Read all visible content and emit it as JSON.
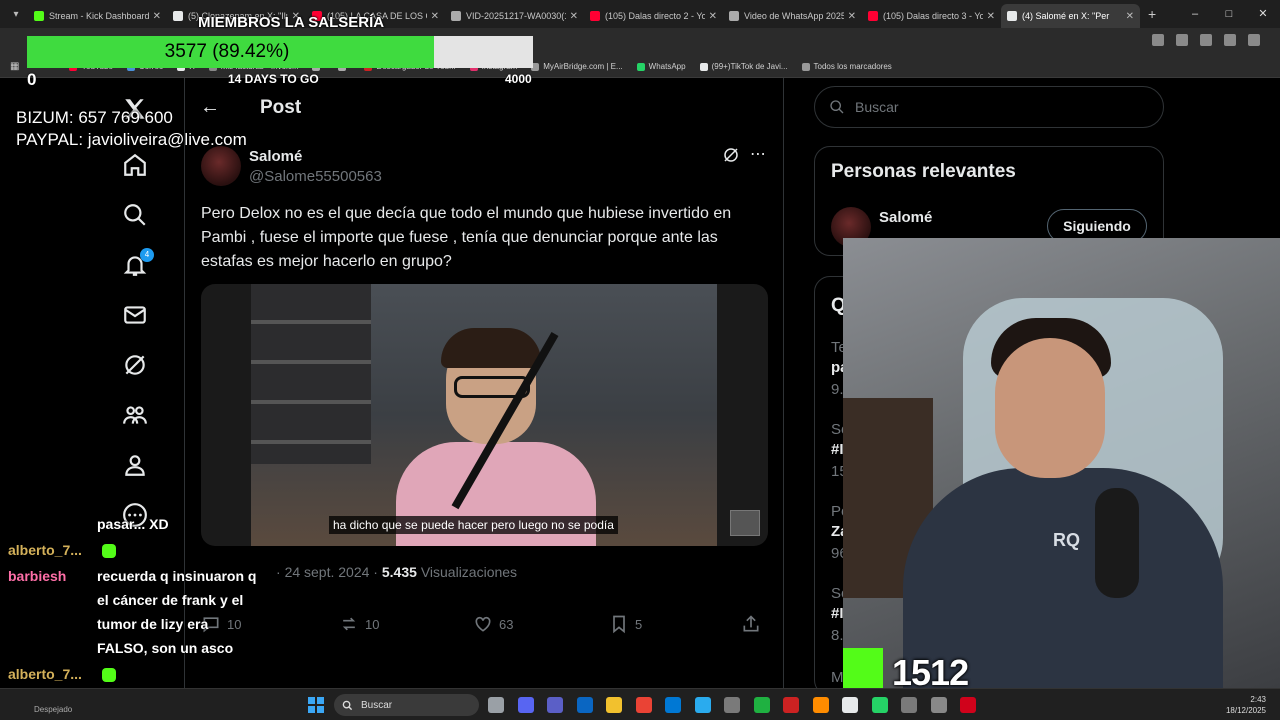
{
  "browser": {
    "tabs": [
      {
        "title": "Stream - Kick Dashboard",
        "color": "#53fc18",
        "active": false
      },
      {
        "title": "(5) Clonazepam en X: \"Ilu",
        "color": "#e7e9ea",
        "active": false
      },
      {
        "title": "(105) LA CASA DE LOS GI",
        "color": "#ff0033",
        "active": false
      },
      {
        "title": "VID-20251217-WA0030(1",
        "color": "#aaaaaa",
        "active": false
      },
      {
        "title": "(105) Dalas directo 2 - Yo",
        "color": "#ff0033",
        "active": false
      },
      {
        "title": "Video de WhatsApp 2025",
        "color": "#aaaaaa",
        "active": false
      },
      {
        "title": "(105) Dalas directo 3 - Yo",
        "color": "#ff0033",
        "active": false
      },
      {
        "title": "(4) Salomé en X: \"Per",
        "color": "#e7e9ea",
        "active": true
      }
    ],
    "bookmarks": [
      {
        "label": "YouTube",
        "color": "#ff0033"
      },
      {
        "label": "Correo",
        "color": "#4a90d9"
      },
      {
        "label": "X",
        "color": "#e7e9ea"
      },
      {
        "label": "Mis facturas - Invoic...",
        "color": "#888888"
      },
      {
        "label": "",
        "color": "#aaaaaa"
      },
      {
        "label": "",
        "color": "#aaaaaa"
      },
      {
        "label": "Descargador de You...",
        "color": "#cc2222"
      },
      {
        "label": "Instagram",
        "color": "#e1306c"
      },
      {
        "label": "MyAirBridge.com | E...",
        "color": "#999999"
      },
      {
        "label": "WhatsApp",
        "color": "#25d366"
      },
      {
        "label": "(99+)TikTok de Javi...",
        "color": "#e7e9ea"
      },
      {
        "label": "Todos los marcadores",
        "color": "#999999"
      }
    ]
  },
  "post": {
    "header_title": "Post",
    "author_name": "Salomé",
    "author_handle": "@Salome55500563",
    "text": "Pero Delox no es el que decía que todo el mundo que hubiese invertido en Pambi , fuese el importe que fuese , tenía que denunciar porque ante las estafas es mejor hacerlo en grupo?",
    "video_caption": "ha dicho que se puede hacer pero luego no se podía",
    "date": "24 sept. 2024",
    "views_count": "5.435",
    "views_label": "Visualizaciones",
    "replies": "10",
    "reposts": "10",
    "likes": "63",
    "bookmarks": "5",
    "notification_badge": "4"
  },
  "right": {
    "search_placeholder": "Buscar",
    "relevant_title": "Personas relevantes",
    "relevant_name": "Salomé",
    "follow_label": "Siguiendo",
    "trend_fragments": [
      "Q",
      "Te",
      "pa",
      "9.",
      "So",
      "#I",
      "15",
      "Po",
      "Za",
      "96",
      "So",
      "#I",
      "8.",
      "M"
    ]
  },
  "overlay": {
    "sub_title": "MIEMBROS LA SALSERÍA",
    "sub_progress_text": "3577 (89.42%)",
    "sub_progress": 0.8942,
    "sub_min": "0",
    "sub_days": "14 DAYS TO GO",
    "sub_max": "4000",
    "bizum": "BIZUM: 657 769 600",
    "paypal": "PAYPAL: javioliveira@live.com",
    "viewer_count": "1512"
  },
  "chat": [
    {
      "user": "",
      "text": "pasar... XD",
      "color": "#ffffff"
    },
    {
      "user": "alberto_7...",
      "text": "",
      "color": "#d4b15a"
    },
    {
      "user": "barbiesh",
      "text": "recuerda q insinuaron q",
      "color": "#ff6fa8"
    },
    {
      "user": "",
      "text": "el cáncer de frank y el",
      "color": "#ffffff"
    },
    {
      "user": "",
      "text": "tumor de lizy era",
      "color": "#ffffff"
    },
    {
      "user": "",
      "text": "FALSO, son un asco",
      "color": "#ffffff"
    },
    {
      "user": "alberto_7...",
      "text": "",
      "color": "#d4b15a"
    },
    {
      "user": "alberto_7...",
      "text": "",
      "color": "#d4b15a"
    }
  ],
  "taskbar": {
    "weather": "Despejado",
    "search_label": "Buscar",
    "time": "2:43",
    "date": "18/12/2025"
  }
}
